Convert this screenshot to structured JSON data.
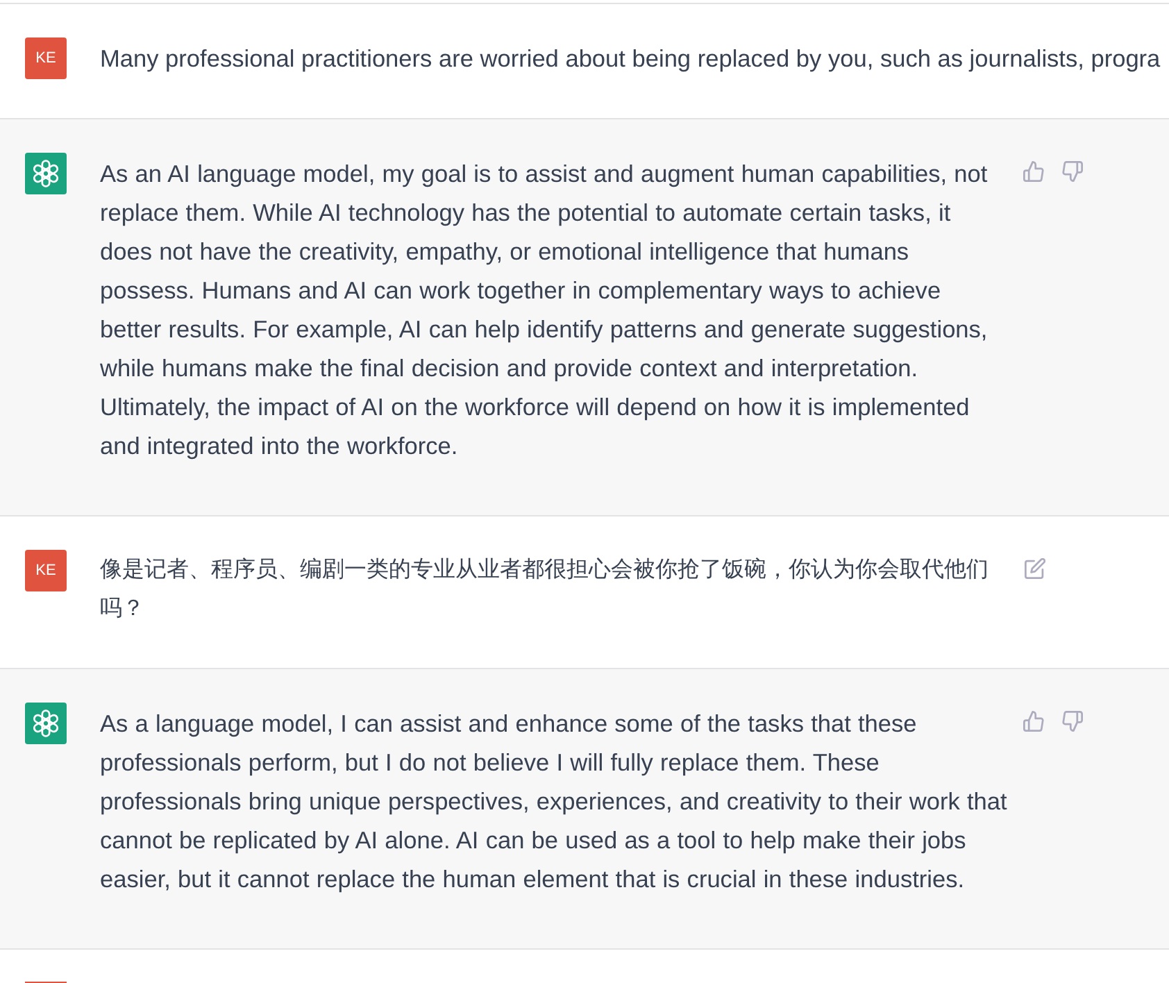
{
  "messages": [
    {
      "kind": "user",
      "avatar": "KE",
      "text": "Many professional practitioners are worried about being replaced by you, such as journalists, progra",
      "editable": false
    },
    {
      "kind": "assistant",
      "text": "As an AI language model, my goal is to assist and augment human capabilities, not replace them. While AI technology has the potential to automate certain tasks, it does not have the creativity, empathy, or emotional intelligence that humans possess. Humans and AI can work together in complementary ways to achieve better results. For example, AI can help identify patterns and generate suggestions, while humans make the final decision and provide context and interpretation. Ultimately, the impact of AI on the workforce will depend on how it is implemented and integrated into the workforce."
    },
    {
      "kind": "user",
      "avatar": "KE",
      "text": "像是记者、程序员、编剧一类的专业从业者都很担心会被你抢了饭碗，你认为你会取代他们吗？",
      "editable": true
    },
    {
      "kind": "assistant",
      "text": "As a language model, I can assist and enhance some of the tasks that these professionals perform, but I do not believe I will fully replace them. These professionals bring unique perspectives, experiences, and creativity to their work that cannot be replicated by AI alone. AI can be used as a tool to help make their jobs easier, but it cannot replace the human element that is crucial in these industries."
    },
    {
      "kind": "user"
    }
  ]
}
